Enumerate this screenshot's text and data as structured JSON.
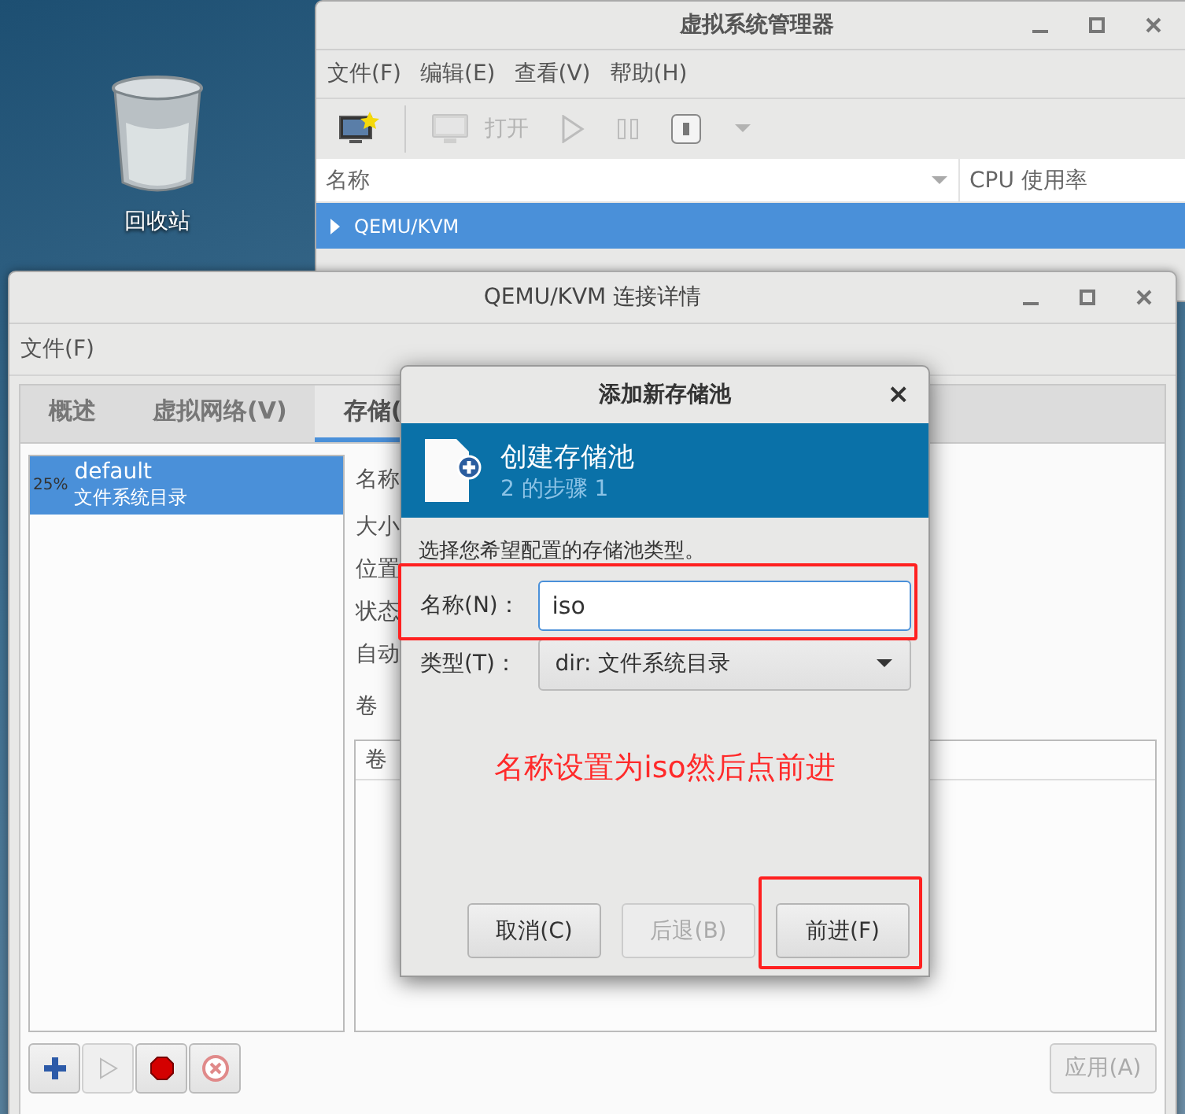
{
  "desktop": {
    "icons": [
      {
        "label": "回收站"
      }
    ]
  },
  "manager_window": {
    "title": "虚拟系统管理器",
    "menu": [
      "文件(F)",
      "编辑(E)",
      "查看(V)",
      "帮助(H)"
    ],
    "toolbar": [
      {
        "kind": "new",
        "disabled": false
      },
      {
        "kind": "open",
        "label": "打开",
        "disabled": true
      },
      {
        "kind": "play",
        "disabled": true
      },
      {
        "kind": "pause",
        "disabled": true
      },
      {
        "kind": "shutdown",
        "disabled": false
      },
      {
        "kind": "menu",
        "disabled": true
      }
    ],
    "columns": [
      "名称",
      "CPU 使用率"
    ],
    "rows": [
      {
        "name": "QEMU/KVM",
        "selected": true,
        "expanded": false
      }
    ]
  },
  "details_window": {
    "title": "QEMU/KVM 连接详情",
    "menu": [
      "文件(F)"
    ],
    "tabs": [
      {
        "label": "概述",
        "selected": false
      },
      {
        "label": "虚拟网络(V)",
        "selected": false
      },
      {
        "label": "存储(",
        "selected": true
      }
    ],
    "pools": [
      {
        "usage": "25%",
        "name": "default",
        "type": "文件系统目录",
        "selected": true
      }
    ],
    "fields": [
      "名称",
      "大小",
      "位置",
      "状态",
      "自动"
    ],
    "volumes_label": "卷",
    "volume_columns": [
      "卷"
    ],
    "pool_buttons": [
      {
        "kind": "add",
        "disabled": false
      },
      {
        "kind": "start",
        "disabled": true
      },
      {
        "kind": "stop",
        "disabled": false
      },
      {
        "kind": "delete",
        "disabled": false
      }
    ],
    "apply": {
      "label": "应用(A)",
      "disabled": true
    }
  },
  "dialog": {
    "title": "添加新存储池",
    "close": "×",
    "heading": "创建存储池",
    "step": "2 的步骤 1",
    "prompt": "选择您希望配置的存储池类型。",
    "fields": [
      {
        "kind": "text",
        "label": "名称(N)：",
        "value": "iso"
      },
      {
        "kind": "select",
        "label": "类型(T)：",
        "value": "dir: 文件系统目录"
      }
    ],
    "buttons": [
      {
        "label": "取消(C)",
        "disabled": false
      },
      {
        "label": "后退(B)",
        "disabled": true
      },
      {
        "label": "前进(F)",
        "disabled": false
      }
    ],
    "note": "名称设置为iso然后点前进"
  }
}
